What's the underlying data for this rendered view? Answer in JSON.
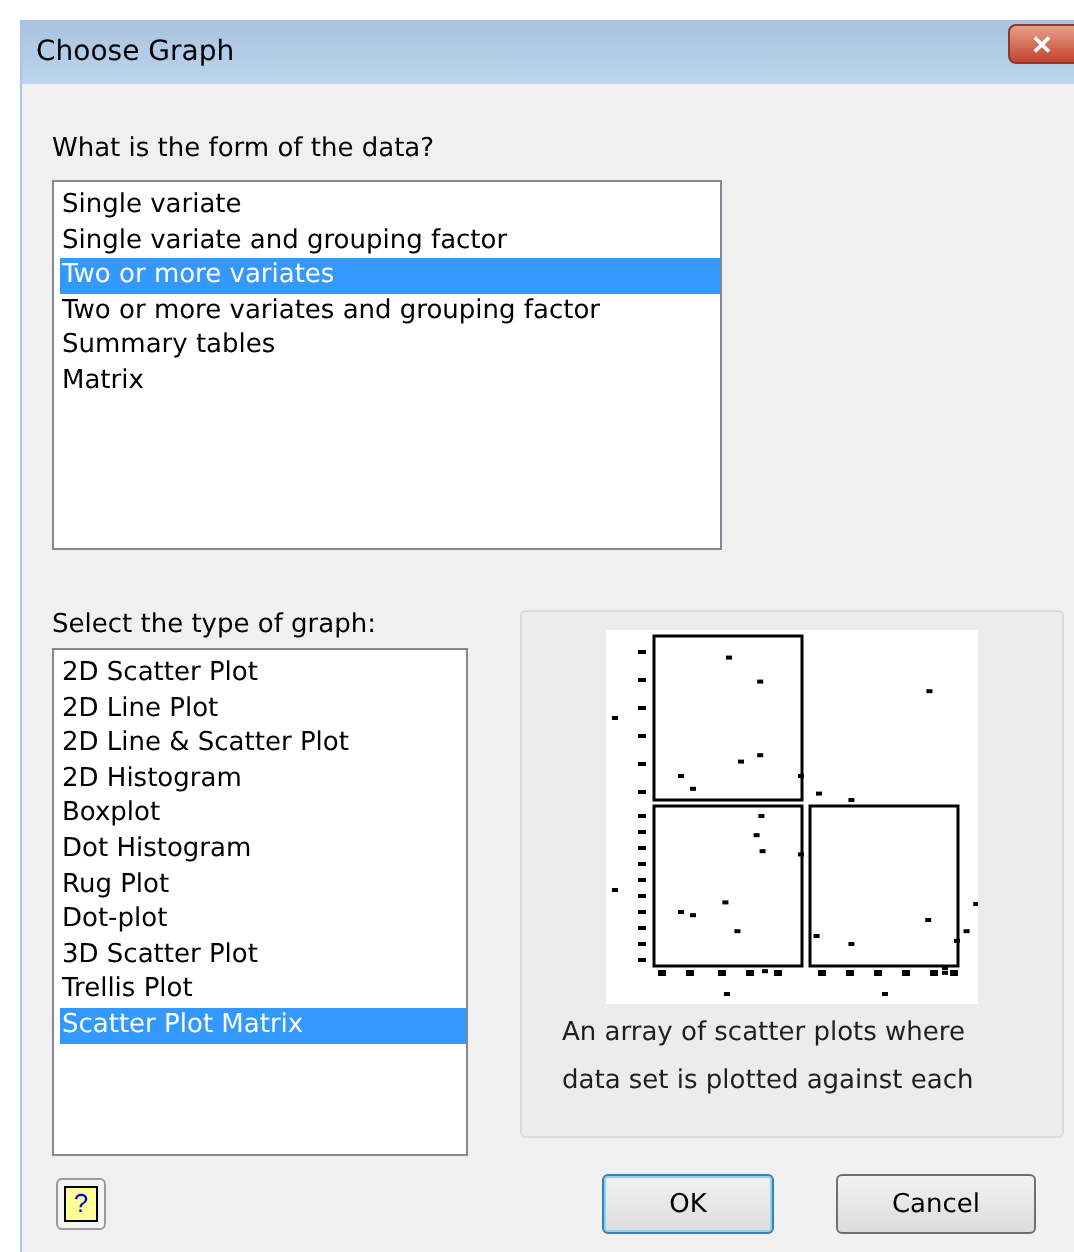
{
  "window": {
    "title": "Choose Graph",
    "close": "✕"
  },
  "form_prompt": "What is the form of the data?",
  "form_list": [
    {
      "label": "Single variate",
      "selected": false
    },
    {
      "label": "Single variate and grouping factor",
      "selected": false
    },
    {
      "label": "Two or more variates",
      "selected": true
    },
    {
      "label": "Two or more variates and grouping factor",
      "selected": false
    },
    {
      "label": "Summary tables",
      "selected": false
    },
    {
      "label": "Matrix",
      "selected": false
    }
  ],
  "graph_prompt": "Select the type of graph:",
  "graph_list": [
    {
      "label": "2D Scatter Plot",
      "selected": false
    },
    {
      "label": "2D Line Plot",
      "selected": false
    },
    {
      "label": "2D Line & Scatter Plot",
      "selected": false
    },
    {
      "label": "2D Histogram",
      "selected": false
    },
    {
      "label": "Boxplot",
      "selected": false
    },
    {
      "label": "Dot Histogram",
      "selected": false
    },
    {
      "label": "Rug Plot",
      "selected": false
    },
    {
      "label": "Dot-plot",
      "selected": false
    },
    {
      "label": "3D Scatter Plot",
      "selected": false
    },
    {
      "label": "Trellis Plot",
      "selected": false
    },
    {
      "label": "Scatter Plot Matrix",
      "selected": true
    }
  ],
  "preview": {
    "description": "An array of scatter plots where data set is plotted against each"
  },
  "buttons": {
    "help": "?",
    "ok": "OK",
    "cancel": "Cancel"
  }
}
